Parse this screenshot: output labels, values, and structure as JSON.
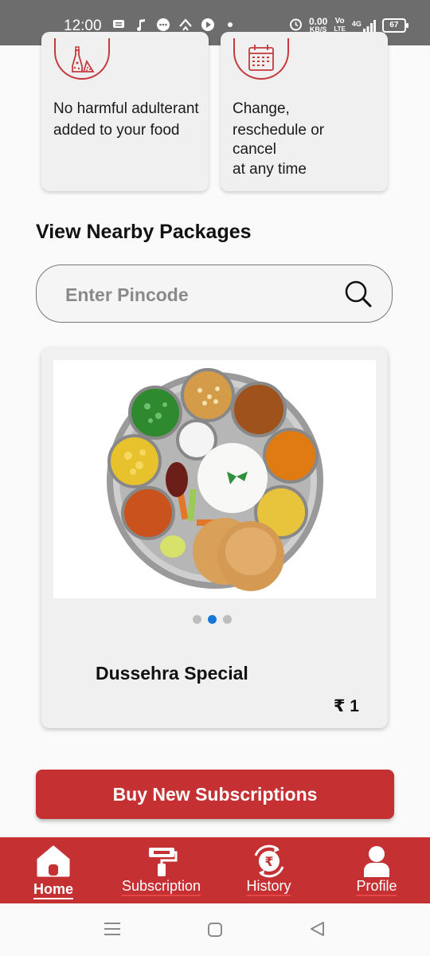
{
  "status_bar": {
    "time": "12:00",
    "net_speed_value": "0.00",
    "net_speed_unit": "KB/S",
    "volte_top": "Vo",
    "volte_bottom": "LTE",
    "network": "4G",
    "battery": "67"
  },
  "features": [
    {
      "icon": "salt-spices-icon",
      "text": "No harmful adulterant added to your food"
    },
    {
      "icon": "calendar-icon",
      "text_lines": [
        "Change,",
        "reschedule or",
        "cancel",
        "at any time"
      ]
    }
  ],
  "nearby": {
    "title": "View Nearby Packages",
    "search_placeholder": "Enter Pincode"
  },
  "package": {
    "name": "Dussehra Special",
    "price": "₹ 1",
    "carousel_active_index": 1,
    "carousel_count": 3
  },
  "buy_button": "Buy New Subscriptions",
  "bottom_nav": [
    {
      "label": "Home",
      "icon": "home-icon",
      "active": true
    },
    {
      "label": "Subscription",
      "icon": "paint-roller-icon",
      "active": false
    },
    {
      "label": "History",
      "icon": "rupee-history-icon",
      "active": false
    },
    {
      "label": "Profile",
      "icon": "user-icon",
      "active": false
    }
  ],
  "colors": {
    "brand": "#c53033",
    "status_bar": "#6d6d6d",
    "dot_active": "#1677d9"
  }
}
